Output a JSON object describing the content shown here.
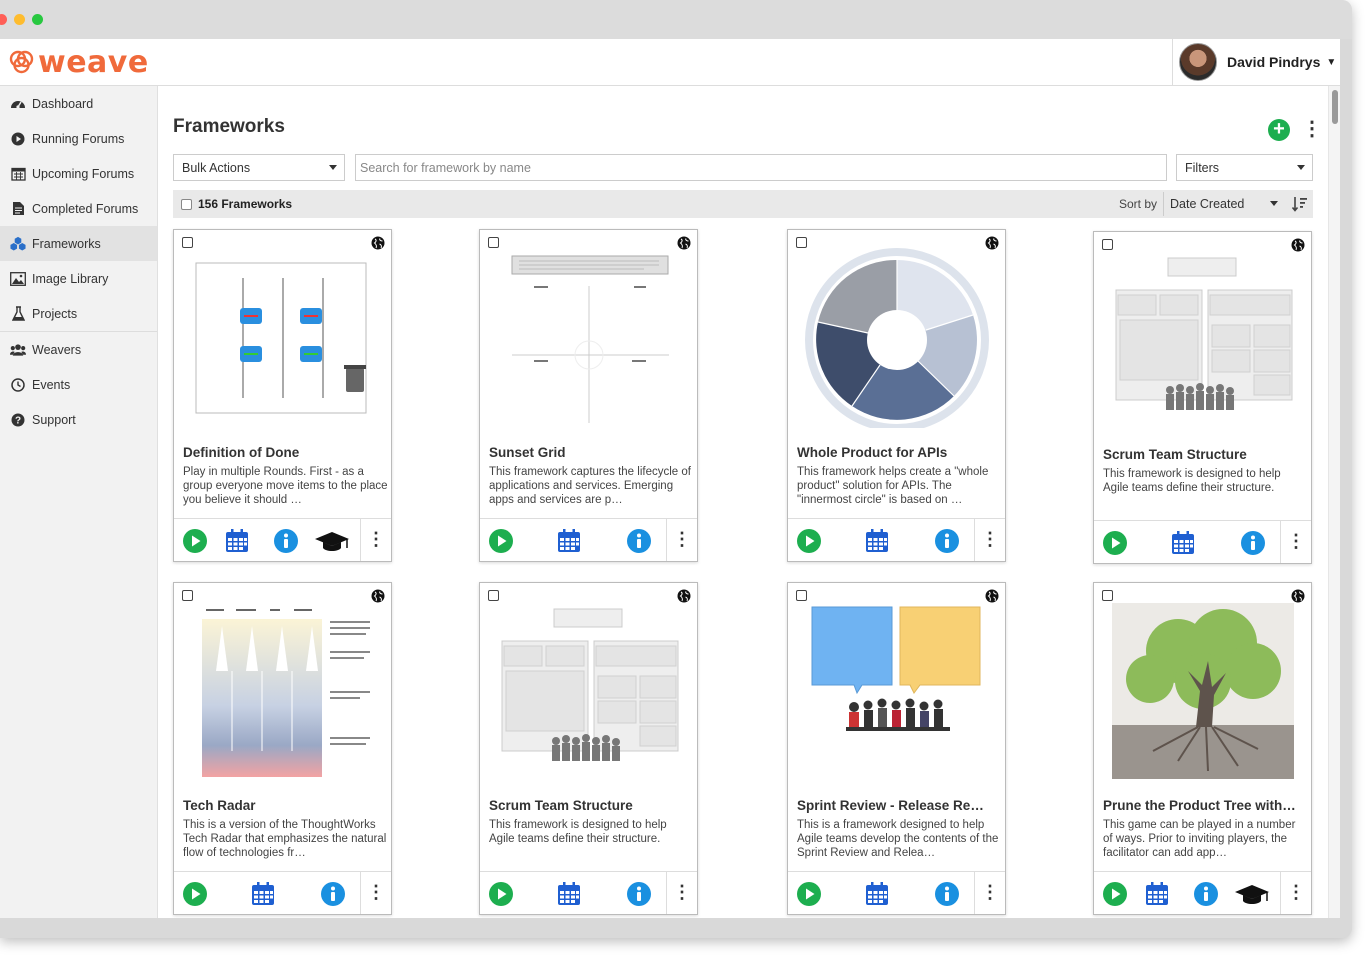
{
  "app": {
    "logo_text": "weave",
    "user_name": "David Pindrys"
  },
  "sidebar": {
    "items": [
      {
        "label": "Dashboard",
        "icon": "dashboard-icon"
      },
      {
        "label": "Running Forums",
        "icon": "play-circle-icon"
      },
      {
        "label": "Upcoming Forums",
        "icon": "calendar-icon"
      },
      {
        "label": "Completed Forums",
        "icon": "document-icon"
      },
      {
        "label": "Frameworks",
        "icon": "cubes-icon",
        "active": true
      },
      {
        "label": "Image Library",
        "icon": "image-icon"
      },
      {
        "label": "Projects",
        "icon": "flask-icon"
      },
      {
        "label": "Weavers",
        "icon": "users-icon"
      },
      {
        "label": "Events",
        "icon": "clock-icon"
      },
      {
        "label": "Support",
        "icon": "question-icon"
      }
    ]
  },
  "main": {
    "title": "Frameworks",
    "bulk_actions": "Bulk Actions",
    "search_placeholder": "Search for framework by name",
    "filters": "Filters",
    "count_label": "156 Frameworks",
    "sort_by": "Sort by",
    "sort_value": "Date Created"
  },
  "cards": [
    {
      "title": "Definition of Done",
      "desc": "Play in multiple Rounds. First - as a group everyone move items to the place you believe it should …",
      "thumb": "dod",
      "badge": true
    },
    {
      "title": "Sunset Grid",
      "desc": "This framework captures the lifecycle of applications and services. Emerging apps and services are p…",
      "thumb": "grid",
      "badge": false
    },
    {
      "title": "Whole Product for APIs",
      "desc": "This framework helps create a \"whole product\" solution for APIs. The \"innermost circle\" is based on …",
      "thumb": "wheel",
      "badge": false
    },
    {
      "title": "Scrum Team Structure",
      "desc": "This framework is designed to help Agile teams define their structure.",
      "thumb": "scrum",
      "badge": false
    },
    {
      "title": "Tech Radar",
      "desc": "This is a version of the ThoughtWorks Tech Radar that emphasizes the natural flow of technologies fr…",
      "thumb": "radar",
      "badge": false
    },
    {
      "title": "Scrum Team Structure",
      "desc": "This framework is designed to help Agile teams define their structure.",
      "thumb": "scrum",
      "badge": false
    },
    {
      "title": "Sprint Review - Release Re…",
      "desc": "This is a framework designed to help Agile teams develop the contents of the Sprint Review and Relea…",
      "thumb": "sprint",
      "badge": false
    },
    {
      "title": "Prune the Product Tree with…",
      "desc": "This game can be played in a number of ways. Prior to inviting players, the facilitator can add app…",
      "thumb": "tree",
      "badge": true
    }
  ],
  "colors": {
    "brand": "#f06a3b",
    "play": "#1dae4f",
    "calendar": "#1f5fd1",
    "info": "#1a90e0"
  }
}
